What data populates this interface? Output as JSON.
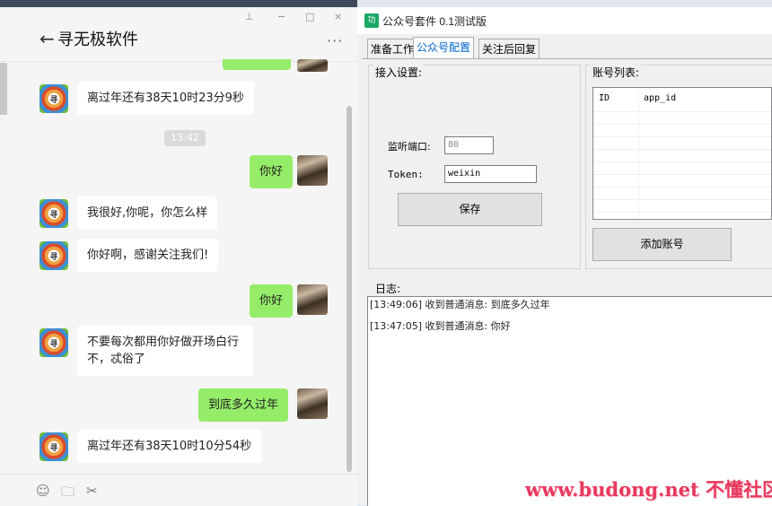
{
  "chat": {
    "title": "寻无极软件",
    "back_icon": "back-arrow-icon",
    "menu_glyph": "···",
    "pin_glyph": "ꟷ",
    "min_glyph": "−",
    "max_glyph": "□",
    "close_glyph": "×",
    "timestamp": "13:42",
    "messages": [
      {
        "from": "bot",
        "text": "离过年还有38天10时23分9秒"
      },
      {
        "from": "me",
        "text": "你好"
      },
      {
        "from": "bot",
        "text": "我很好,你呢，你怎么样"
      },
      {
        "from": "bot",
        "text": "你好啊，感谢关注我们!"
      },
      {
        "from": "me",
        "text": "你好"
      },
      {
        "from": "bot",
        "text": "不要每次都用你好做开场白行不，忒俗了"
      },
      {
        "from": "me",
        "text": "到底多久过年"
      },
      {
        "from": "bot",
        "text": "离过年还有38天10时10分54秒"
      }
    ],
    "bot_avatar_text": "寻"
  },
  "app": {
    "title": "公众号套件 0.1测试版",
    "logo_text": "功",
    "tabs": [
      "准备工作",
      "公众号配置",
      "关注后回复"
    ],
    "active_tab": 1,
    "access": {
      "group_title": "接入设置:",
      "port_label": "监听端口:",
      "port_value": "80",
      "token_label": "Token:",
      "token_value": "weixin",
      "save_label": "保存"
    },
    "accounts": {
      "group_title": "账号列表:",
      "columns": [
        "ID",
        "app_id"
      ],
      "add_label": "添加账号"
    },
    "log": {
      "label": "日志:",
      "lines": [
        "[13:49:06] 收到普通消息: 到底多久过年",
        "[13:47:05] 收到普通消息: 你好"
      ]
    }
  },
  "watermark": "www.budong.net 不懂社区",
  "colors": {
    "out_bubble": "#95ec69",
    "active_tab_text": "#0066cc",
    "watermark": "#e8395d"
  }
}
